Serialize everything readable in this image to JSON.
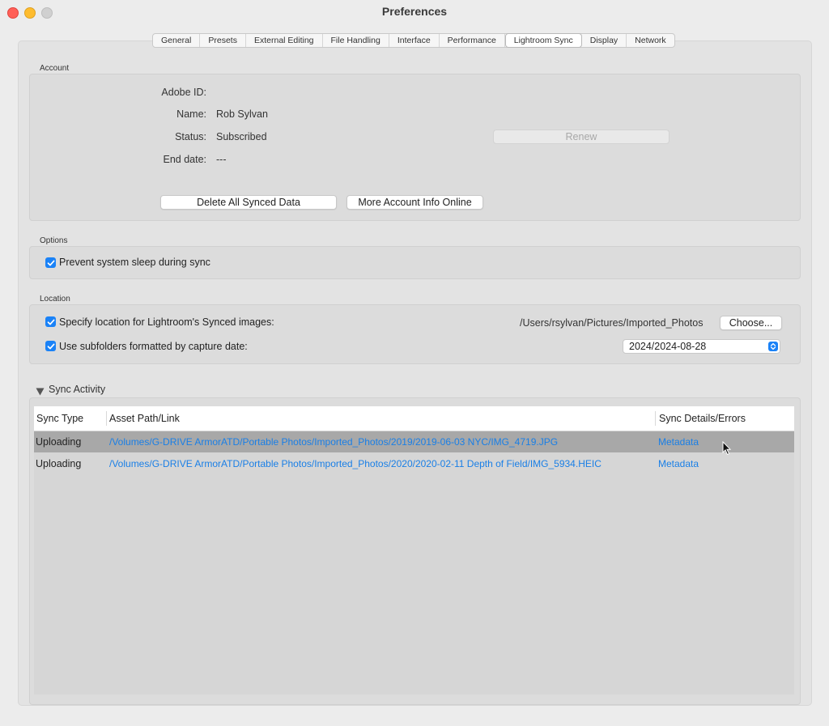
{
  "window": {
    "title": "Preferences"
  },
  "tabs": [
    "General",
    "Presets",
    "External Editing",
    "File Handling",
    "Interface",
    "Performance",
    "Lightroom Sync",
    "Display",
    "Network"
  ],
  "active_tab": "Lightroom Sync",
  "account": {
    "section_label": "Account",
    "adobe_id_label": "Adobe ID:",
    "adobe_id_value": "",
    "name_label": "Name:",
    "name_value": "Rob Sylvan",
    "status_label": "Status:",
    "status_value": "Subscribed",
    "end_date_label": "End date:",
    "end_date_value": "---",
    "renew_button": "Renew",
    "delete_button": "Delete All Synced Data",
    "more_info_button": "More Account Info Online"
  },
  "options": {
    "section_label": "Options",
    "prevent_sleep_label": "Prevent system sleep during sync",
    "prevent_sleep_checked": true
  },
  "location": {
    "section_label": "Location",
    "specify_label": "Specify location for Lightroom's Synced images:",
    "specify_checked": true,
    "path": "/Users/rsylvan/Pictures/Imported_Photos",
    "choose_button": "Choose...",
    "subfolders_label": "Use subfolders formatted by capture date:",
    "subfolders_checked": true,
    "date_format": "2024/2024-08-28"
  },
  "sync_activity": {
    "section_label": "Sync Activity",
    "columns": [
      "Sync Type",
      "Asset Path/Link",
      "Sync Details/Errors"
    ],
    "rows": [
      {
        "type": "Uploading",
        "path": "/Volumes/G-DRIVE ArmorATD/Portable Photos/Imported_Photos/2019/2019-06-03  NYC/IMG_4719.JPG",
        "details": "Metadata",
        "selected": true
      },
      {
        "type": "Uploading",
        "path": "/Volumes/G-DRIVE ArmorATD/Portable Photos/Imported_Photos/2020/2020-02-11 Depth of Field/IMG_5934.HEIC",
        "details": "Metadata",
        "selected": false
      }
    ]
  },
  "colors": {
    "accent": "#1a82f7",
    "link": "#1a7fe6",
    "selected_row": "#a8a8a8"
  }
}
